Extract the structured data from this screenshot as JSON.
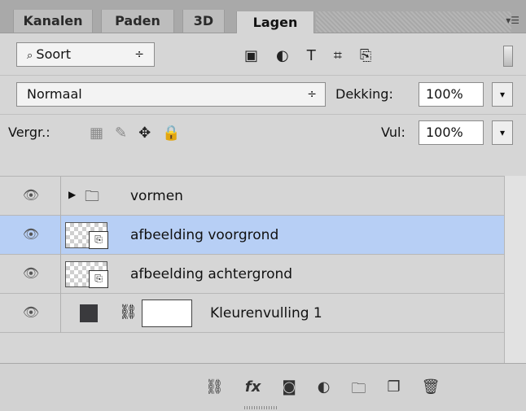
{
  "tabs": [
    {
      "label": "Kanalen"
    },
    {
      "label": "Paden"
    },
    {
      "label": "3D"
    },
    {
      "label": "Lagen"
    }
  ],
  "filter": {
    "label": "Soort",
    "arrow": "÷"
  },
  "blend": {
    "mode": "Normaal",
    "arrow": "÷",
    "opacity_label": "Dekking:",
    "opacity_value": "100%"
  },
  "lock": {
    "label": "Vergr.:",
    "fill_label": "Vul:",
    "fill_value": "100%"
  },
  "layers": [
    {
      "name": "vormen",
      "type": "group"
    },
    {
      "name": "afbeelding voorgrond",
      "type": "smart-object",
      "selected": true
    },
    {
      "name": "afbeelding achtergrond",
      "type": "smart-object"
    },
    {
      "name": "Kleurenvulling 1",
      "type": "fill"
    }
  ],
  "colors": {
    "selected": "#b7cff5",
    "panel": "#d6d6d6",
    "fill_swatch": "#3a3a3d"
  }
}
